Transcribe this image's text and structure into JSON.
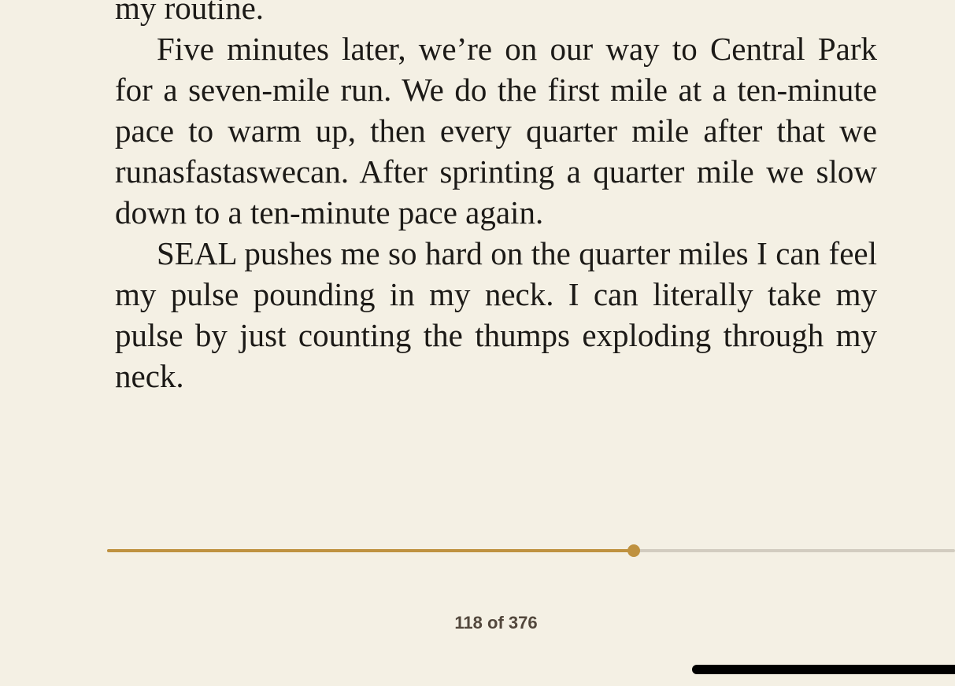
{
  "book": {
    "paragraphs": [
      {
        "text": "my routine.",
        "indent": false
      },
      {
        "text": "Five minutes later, we’re on our way to Central Park for a seven-mile run. We do the first mile at a ten-minute pace to warm up, then every quarter mile after that we runasfastaswecan. After sprinting a quarter mile we slow down to a ten-minute pace again.",
        "indent": true
      },
      {
        "text": "SEAL pushes me so hard on the quarter miles I can feel my pulse pounding in my neck. I can literally take my pulse by just counting the thumps exploding through my neck.",
        "indent": true
      }
    ]
  },
  "progress": {
    "fraction": 0.621,
    "accent_color": "#bf9240",
    "track_color": "#d2ccc0"
  },
  "pagination": {
    "label": "118 of 376"
  }
}
